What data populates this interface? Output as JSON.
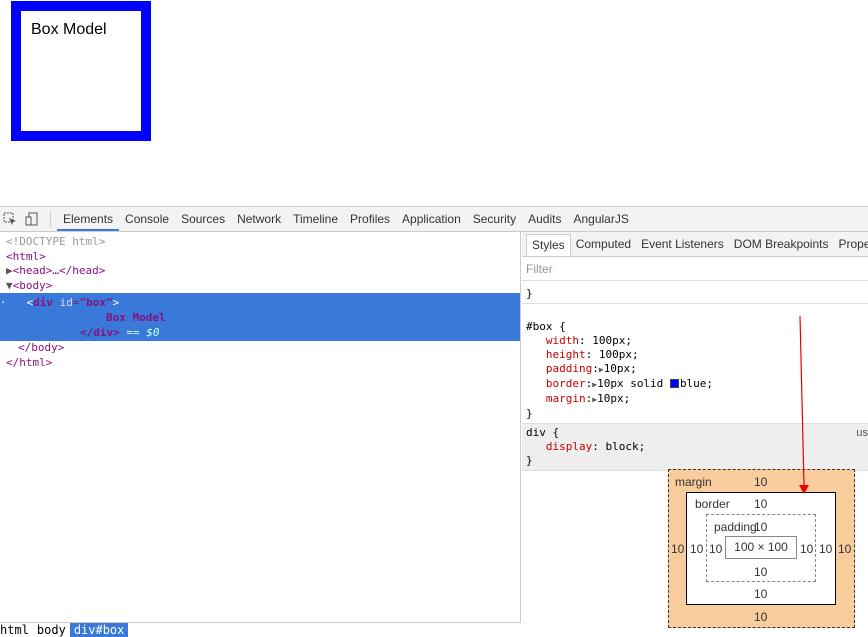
{
  "page": {
    "box_text": "Box Model"
  },
  "toolbar": {
    "tabs": [
      "Elements",
      "Console",
      "Sources",
      "Network",
      "Timeline",
      "Profiles",
      "Application",
      "Security",
      "Audits",
      "AngularJS"
    ]
  },
  "dom": {
    "doctype": "<!DOCTYPE html>",
    "html_open": "<html>",
    "head": "<head>…</head>",
    "body_open": "<body>",
    "div_tag": "div",
    "div_attr": "id",
    "div_val": "\"box\"",
    "div_text": "Box Model",
    "div_close": "</div>",
    "dollar": "== $0",
    "body_close": "</body>",
    "html_close": "</html>"
  },
  "breadcrumbs": [
    "html",
    "body",
    "div#box"
  ],
  "sidebar": {
    "tabs": [
      "Styles",
      "Computed",
      "Event Listeners",
      "DOM Breakpoints",
      "Propert"
    ],
    "filter_placeholder": "Filter",
    "rules": {
      "prev_close": "}",
      "box_selector": "#box {",
      "width": "width",
      "width_val": "100px;",
      "height": "height",
      "height_val": "100px;",
      "padding": "padding",
      "padding_val": "10px;",
      "border": "border",
      "border_val": "10px solid ",
      "border_color": "blue;",
      "margin": "margin",
      "margin_val": "10px;",
      "close": "}",
      "div_selector": "div {",
      "ua_label": "us",
      "display": "display",
      "display_val": "block;"
    }
  },
  "box_model": {
    "margin_label": "margin",
    "border_label": "border",
    "padding_label": "padding",
    "margin": [
      "10",
      "10",
      "10",
      "10"
    ],
    "border": [
      "10",
      "10",
      "10",
      "10"
    ],
    "padding": [
      "10",
      "10",
      "10",
      "10"
    ],
    "content": "100 × 100",
    "colors": {
      "margin": "#f9cc9d",
      "border_box": "#ffffff"
    }
  }
}
